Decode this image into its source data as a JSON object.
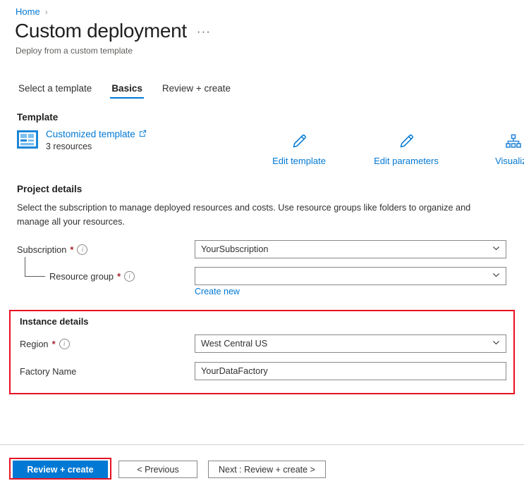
{
  "breadcrumb": {
    "home_label": "Home",
    "separator": "›"
  },
  "header": {
    "title": "Custom deployment",
    "subtitle": "Deploy from a custom template",
    "more_menu": "···"
  },
  "tabs": [
    {
      "label": "Select a template",
      "active": false
    },
    {
      "label": "Basics",
      "active": true
    },
    {
      "label": "Review + create",
      "active": false
    }
  ],
  "template_section": {
    "heading": "Template",
    "link_label": "Customized template",
    "resource_count": "3 resources",
    "icon": "template-grid-icon",
    "external_icon": "external-link-icon",
    "actions": [
      {
        "label": "Edit template",
        "icon": "pencil-icon"
      },
      {
        "label": "Edit parameters",
        "icon": "pencil-icon"
      },
      {
        "label": "Visualize",
        "icon": "hierarchy-icon"
      }
    ]
  },
  "project_details": {
    "heading": "Project details",
    "description": "Select the subscription to manage deployed resources and costs. Use resource groups like folders to organize and manage all your resources.",
    "subscription": {
      "label": "Subscription",
      "required": "*",
      "value": "YourSubscription"
    },
    "resource_group": {
      "label": "Resource group",
      "required": "*",
      "value": "",
      "placeholder": "",
      "create_new_label": "Create new"
    }
  },
  "instance_details": {
    "heading": "Instance details",
    "region": {
      "label": "Region",
      "required": "*",
      "value": "West Central US"
    },
    "factory_name": {
      "label": "Factory Name",
      "value": "YourDataFactory"
    }
  },
  "footer": {
    "review_create_label": "Review + create",
    "previous_label": "< Previous",
    "next_label": "Next : Review + create >"
  },
  "colors": {
    "accent": "#0078d4",
    "highlight": "#e81123",
    "required": "#a4262c",
    "text": "#323130"
  }
}
